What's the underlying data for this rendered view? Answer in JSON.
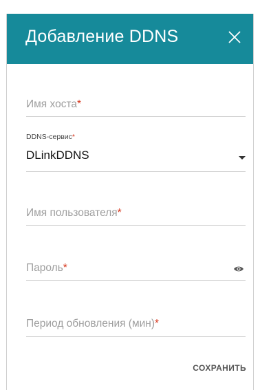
{
  "dialog": {
    "title": "Добавление DDNS",
    "close_icon": "close-icon",
    "header_color": "#168a9a"
  },
  "fields": {
    "hostname": {
      "placeholder": "Имя хоста",
      "required_mark": "*"
    },
    "ddns_service": {
      "label": "DDNS-сервис",
      "required_mark": "*",
      "value": "DLinkDDNS",
      "icon": "chevron-down-icon"
    },
    "username": {
      "placeholder": "Имя пользователя",
      "required_mark": "*"
    },
    "password": {
      "placeholder": "Пароль",
      "required_mark": "*",
      "icon": "eye-icon"
    },
    "update_period": {
      "placeholder": "Период обновления (мин)",
      "required_mark": "*"
    }
  },
  "actions": {
    "save_label": "СОХРАНИТЬ"
  },
  "colors": {
    "required": "#d6341a",
    "placeholder": "#9e9e9e"
  }
}
